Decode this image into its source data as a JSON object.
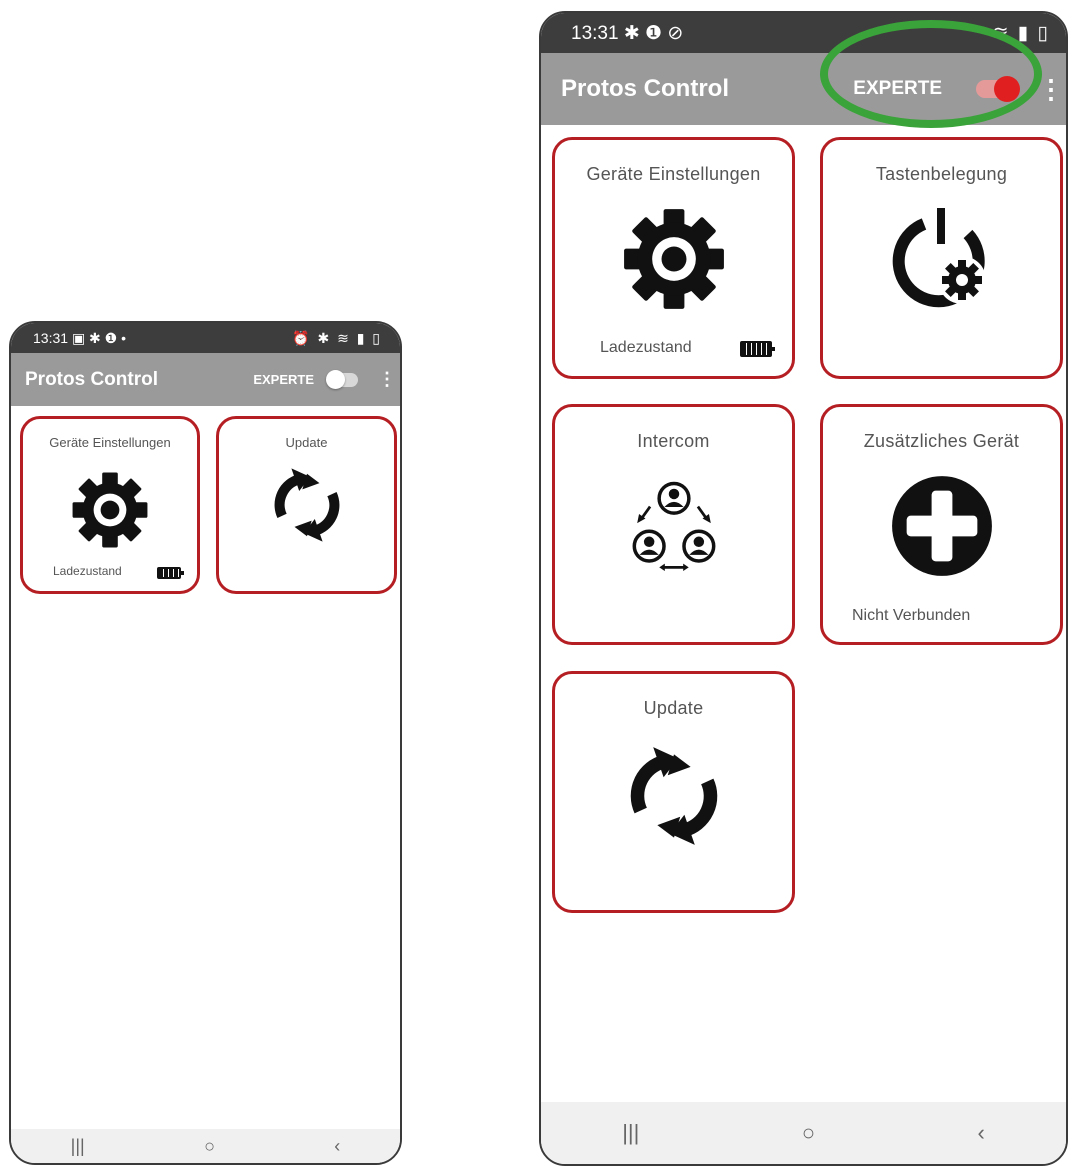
{
  "colors": {
    "tile_border": "#b51f24",
    "toggle_on": "#e02020",
    "highlight": "#3aa33a",
    "appbar": "#9a9a9a",
    "statusbar": "#3d3d3d"
  },
  "small": {
    "status": {
      "time": "13:31",
      "left_icons": "▣ ✱ ❶ •",
      "right_icons": "⏰ ✱ ≋ ▮ ▯"
    },
    "appbar": {
      "title": "Protos Control",
      "mode_label": "EXPERTE",
      "toggle_on": false,
      "menu": "⋮"
    },
    "tiles": {
      "settings": {
        "label": "Geräte Einstellungen",
        "icon": "gear-icon",
        "status": "Ladezustand"
      },
      "update": {
        "label": "Update",
        "icon": "sync-icon"
      }
    },
    "nav": {
      "recent": "|||",
      "home": "○",
      "back": "‹"
    }
  },
  "large": {
    "status": {
      "time": "13:31",
      "left_icons": "✱ ❶ ⊘",
      "right_icons": "≋ ▮ ▯"
    },
    "appbar": {
      "title": "Protos Control",
      "mode_label": "EXPERTE",
      "toggle_on": true,
      "menu": "⋮"
    },
    "tiles": {
      "settings": {
        "label": "Geräte Einstellungen",
        "icon": "gear-icon",
        "status": "Ladezustand"
      },
      "buttons": {
        "label": "Tastenbelegung",
        "icon": "power-gear-icon"
      },
      "intercom": {
        "label": "Intercom",
        "icon": "intercom-group-icon"
      },
      "additional": {
        "label": "Zusätzliches Gerät",
        "icon": "add-circle-icon",
        "status": "Nicht Verbunden"
      },
      "update": {
        "label": "Update",
        "icon": "sync-icon"
      }
    },
    "nav": {
      "recent": "|||",
      "home": "○",
      "back": "‹"
    }
  }
}
